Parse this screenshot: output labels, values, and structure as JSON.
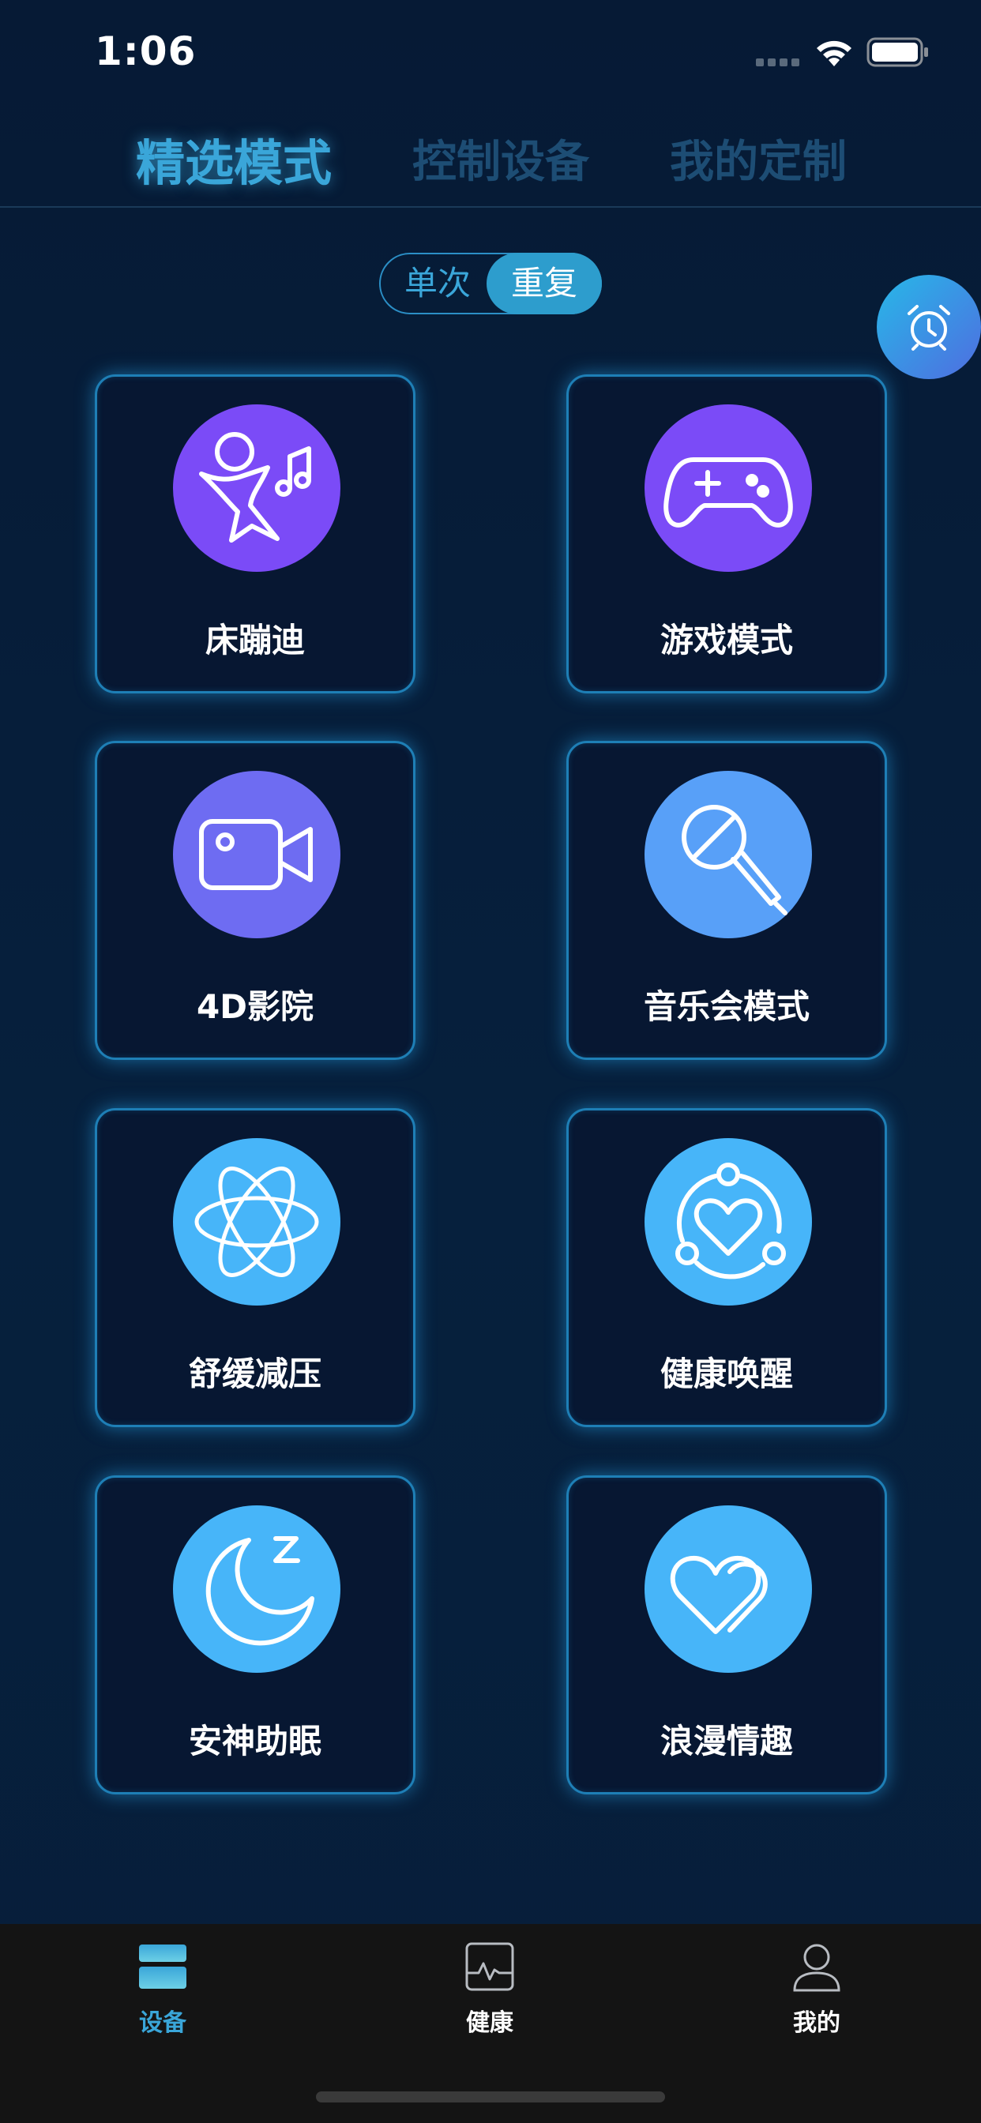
{
  "status_bar": {
    "time": "1:06"
  },
  "top_tabs": [
    {
      "label": "精选模式",
      "active": true
    },
    {
      "label": "控制设备",
      "active": false
    },
    {
      "label": "我的定制",
      "active": false
    }
  ],
  "segment": {
    "options": [
      "单次",
      "重复"
    ],
    "selected": "重复"
  },
  "modes": [
    {
      "label": "床蹦迪",
      "icon": "dancing-person-icon"
    },
    {
      "label": "游戏模式",
      "icon": "gamepad-icon"
    },
    {
      "label": "4D影院",
      "icon": "video-camera-icon"
    },
    {
      "label": "音乐会模式",
      "icon": "microphone-icon"
    },
    {
      "label": "舒缓减压",
      "icon": "atom-icon"
    },
    {
      "label": "健康唤醒",
      "icon": "heart-orbit-icon"
    },
    {
      "label": "安神助眠",
      "icon": "moon-sleep-icon"
    },
    {
      "label": "浪漫情趣",
      "icon": "double-heart-icon"
    }
  ],
  "bottom_nav": [
    {
      "label": "设备",
      "active": true,
      "icon": "devices-icon"
    },
    {
      "label": "健康",
      "active": false,
      "icon": "health-monitor-icon"
    },
    {
      "label": "我的",
      "active": false,
      "icon": "person-icon"
    }
  ],
  "colors": {
    "accent": "#3aa6d9",
    "background": "#061a35",
    "card_border": "#1e7fb6"
  }
}
